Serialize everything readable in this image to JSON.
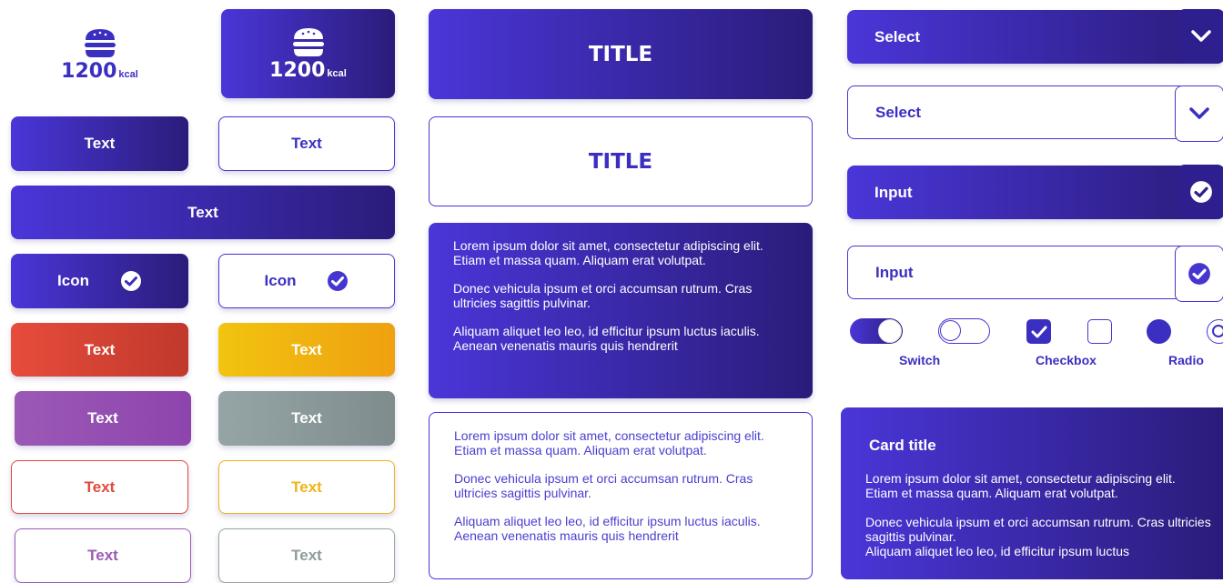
{
  "kcal_widgets": [
    {
      "value": "1200",
      "unit": "kcal",
      "icon": "burger-icon"
    },
    {
      "value": "1200",
      "unit": "kcal",
      "icon": "burger-icon"
    }
  ],
  "buttons": {
    "solid_text": "Text",
    "outline_text": "Text",
    "wide_text": "Text",
    "icon_solid": "Icon",
    "icon_outline": "Icon",
    "red_text": "Text",
    "yellow_text": "Text",
    "purple_text": "Text",
    "gray_text": "Text",
    "red_outline_text": "Text",
    "yellow_outline_text": "Text",
    "purple_outline_text": "Text",
    "gray_outline_text": "Text"
  },
  "titles": {
    "solid": "TITLE",
    "outline": "TITLE"
  },
  "paragraphs": {
    "solid": [
      "Lorem ipsum dolor sit amet, consectetur adipiscing elit. Etiam et massa quam. Aliquam erat volutpat.",
      "Donec vehicula ipsum et orci accumsan rutrum. Cras ultricies sagittis pulvinar.",
      "Aliquam aliquet leo leo, id efficitur ipsum luctus iaculis. Aenean venenatis mauris quis hendrerit"
    ],
    "outline": [
      "Lorem ipsum dolor sit amet, consectetur adipiscing elit. Etiam et massa quam. Aliquam erat volutpat.",
      "Donec vehicula ipsum et orci accumsan rutrum. Cras ultricies sagittis pulvinar.",
      "Aliquam aliquet leo leo, id efficitur ipsum luctus iaculis. Aenean venenatis mauris quis hendrerit"
    ]
  },
  "selects": {
    "solid": "Select",
    "outline": "Select"
  },
  "inputs": {
    "solid": "Input",
    "outline": "Input"
  },
  "controls": {
    "switch_label": "Switch",
    "checkbox_label": "Checkbox",
    "radio_label": "Radio"
  },
  "card": {
    "title": "Card title",
    "paragraphs": [
      "Lorem ipsum dolor sit amet, consectetur adipiscing elit. Etiam et massa quam. Aliquam erat volutpat.",
      "Donec vehicula ipsum et orci accumsan rutrum. Cras ultricies sagittis pulvinar.",
      "Aliquam aliquet leo leo, id efficitur ipsum luctus"
    ]
  },
  "colors": {
    "primary_start": "#4a36d8",
    "primary_end": "#2a1c7a",
    "red": "#e04a3c",
    "yellow": "#f0b418",
    "purple": "#9b59b6",
    "gray": "#8e9c9c"
  }
}
